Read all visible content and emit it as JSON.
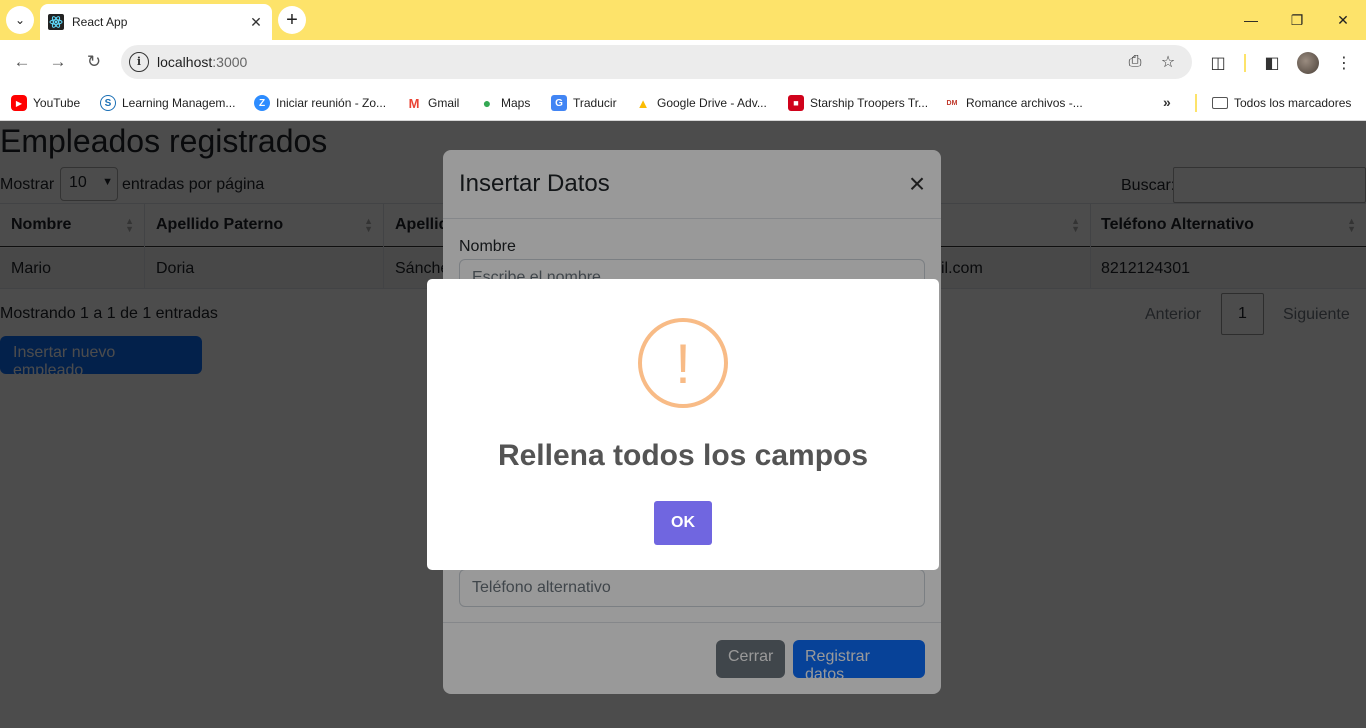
{
  "browser": {
    "tab_title": "React App",
    "url_host": "localhost",
    "url_port": ":3000",
    "bookmarks": [
      {
        "label": "YouTube",
        "icon": "youtube-icon",
        "color": "#ff0000"
      },
      {
        "label": "Learning Managem...",
        "icon": "schoology-icon",
        "color": "#1a6fb5"
      },
      {
        "label": "Iniciar reunión - Zo...",
        "icon": "zoom-icon",
        "color": "#2d8cff"
      },
      {
        "label": "Gmail",
        "icon": "gmail-icon",
        "color": "#ea4335"
      },
      {
        "label": "Maps",
        "icon": "maps-icon",
        "color": "#34a853"
      },
      {
        "label": "Traducir",
        "icon": "translate-icon",
        "color": "#4285f4"
      },
      {
        "label": "Google Drive - Adv...",
        "icon": "drive-icon",
        "color": "#fbbc04"
      },
      {
        "label": "Starship Troopers Tr...",
        "icon": "clapperboard-icon",
        "color": "#d0021b"
      },
      {
        "label": "Romance archivos -...",
        "icon": "site-icon",
        "color": "#c0392b"
      }
    ],
    "all_bookmarks": "Todos los marcadores"
  },
  "page": {
    "title": "Empleados registrados",
    "show_label": "Mostrar",
    "entries_value": "10",
    "per_page_label": "entradas por página",
    "search_label": "Buscar:",
    "columns": [
      "Nombre",
      "Apellido Paterno",
      "Apellid",
      "",
      "Teléfono Alternativo"
    ],
    "rows": [
      [
        "Mario",
        "Doria",
        "Sánche",
        "il.com",
        "8212124301"
      ]
    ],
    "info": "Mostrando 1 a 1 de 1 entradas",
    "prev": "Anterior",
    "page_number": "1",
    "next": "Siguiente",
    "new_button": "Insertar nuevo empleado"
  },
  "modal": {
    "title": "Insertar Datos",
    "name_label": "Nombre",
    "name_placeholder": "Escribe el nombre",
    "alt_phone_placeholder": "Teléfono alternativo",
    "close_button": "Cerrar",
    "submit_button": "Registrar datos"
  },
  "alert": {
    "icon_glyph": "!",
    "title": "Rellena todos los campos",
    "ok_button": "OK"
  },
  "colors": {
    "primary": "#0d6efd",
    "secondary": "#6c757d",
    "swal_confirm": "#7066e0",
    "swal_warning": "#f8bb86",
    "chrome_theme": "#fde36a"
  }
}
